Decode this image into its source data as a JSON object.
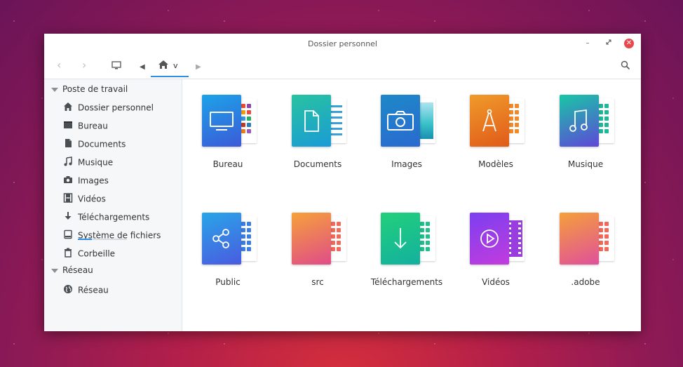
{
  "window": {
    "title": "Dossier personnel",
    "min_icon": "minimize-icon",
    "max_icon": "maximize-icon",
    "close_icon": "close-icon"
  },
  "toolbar": {
    "back": "‹",
    "forward": "›",
    "computer": "🖥",
    "breadcrumb_home": "v",
    "search_icon": "search-icon"
  },
  "sidebar": {
    "section1": "Poste de travail",
    "items": [
      {
        "label": "Dossier personnel",
        "icon": "home-icon"
      },
      {
        "label": "Bureau",
        "icon": "desktop-icon"
      },
      {
        "label": "Documents",
        "icon": "document-icon"
      },
      {
        "label": "Musique",
        "icon": "music-icon"
      },
      {
        "label": "Images",
        "icon": "camera-icon"
      },
      {
        "label": "Vidéos",
        "icon": "film-icon"
      },
      {
        "label": "Téléchargements",
        "icon": "download-icon"
      },
      {
        "label": "Système de fichiers",
        "icon": "drive-icon"
      },
      {
        "label": "Corbeille",
        "icon": "trash-icon"
      }
    ],
    "section2": "Réseau",
    "network_items": [
      {
        "label": "Réseau",
        "icon": "globe-icon"
      }
    ]
  },
  "folders": [
    {
      "label": "Bureau",
      "icon": "monitor-icon",
      "color_a": "#1ca3e8",
      "color_b": "#3c5ad8"
    },
    {
      "label": "Documents",
      "icon": "file-icon",
      "color_a": "#27c3a0",
      "color_b": "#1b9bd6"
    },
    {
      "label": "Images",
      "icon": "camera-icon",
      "color_a": "#1e88c8",
      "color_b": "#2a6ad0"
    },
    {
      "label": "Modèles",
      "icon": "compass-icon",
      "color_a": "#f09b2a",
      "color_b": "#e05a1a"
    },
    {
      "label": "Musique",
      "icon": "music-note-icon",
      "color_a": "#18c7a6",
      "color_b": "#5f47d8"
    },
    {
      "label": "Public",
      "icon": "share-icon",
      "color_a": "#29a5e8",
      "color_b": "#4a5be0"
    },
    {
      "label": "src",
      "icon": "",
      "color_a": "#f6a13a",
      "color_b": "#e04c88"
    },
    {
      "label": "Téléchargements",
      "icon": "download-icon",
      "color_a": "#22d07a",
      "color_b": "#13b0a0"
    },
    {
      "label": "Vidéos",
      "icon": "play-icon",
      "color_a": "#7b3ff0",
      "color_b": "#c23cde"
    },
    {
      "label": ".adobe",
      "icon": "",
      "color_a": "#f5a03a",
      "color_b": "#e0509a"
    }
  ]
}
